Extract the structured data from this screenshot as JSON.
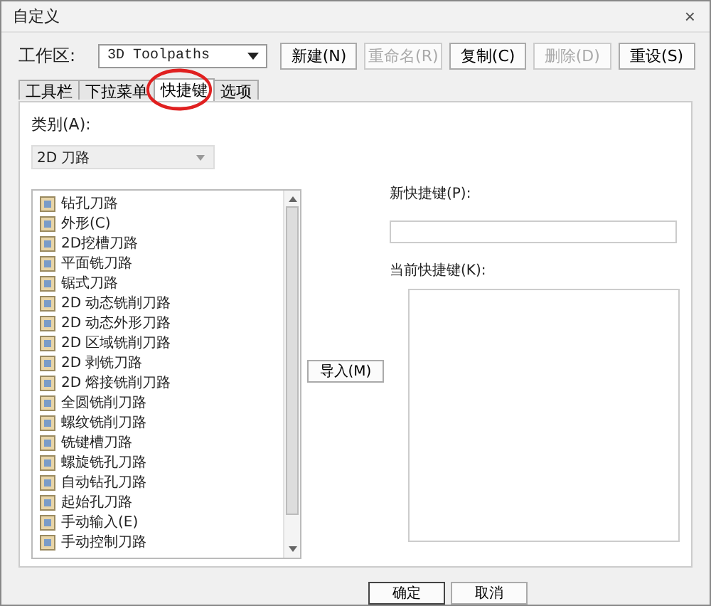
{
  "window": {
    "title": "自定义",
    "close": "×"
  },
  "workspace": {
    "label": "工作区:",
    "value": "3D Toolpaths"
  },
  "toolbar_buttons": [
    {
      "label": "新建(N)",
      "disabled": false
    },
    {
      "label": "重命名(R)",
      "disabled": true
    },
    {
      "label": "复制(C)",
      "disabled": false
    },
    {
      "label": "删除(D)",
      "disabled": true
    },
    {
      "label": "重设(S)",
      "disabled": false
    }
  ],
  "tabs": [
    {
      "label": "工具栏",
      "selected": false,
      "circled": false
    },
    {
      "label": "下拉菜单",
      "selected": false,
      "circled": false
    },
    {
      "label": "快捷键",
      "selected": true,
      "circled": true
    },
    {
      "label": "选项",
      "selected": false,
      "circled": false
    }
  ],
  "category": {
    "label": "类别(A):",
    "value": "2D 刀路"
  },
  "commands": [
    {
      "label": "钻孔刀路"
    },
    {
      "label": "外形(C)"
    },
    {
      "label": "2D挖槽刀路"
    },
    {
      "label": "平面铣刀路"
    },
    {
      "label": "锯式刀路"
    },
    {
      "label": "2D 动态铣削刀路"
    },
    {
      "label": "2D 动态外形刀路"
    },
    {
      "label": "2D 区域铣削刀路"
    },
    {
      "label": "2D 剥铣刀路"
    },
    {
      "label": "2D 熔接铣削刀路"
    },
    {
      "label": "全圆铣削刀路"
    },
    {
      "label": "螺纹铣削刀路"
    },
    {
      "label": "铣键槽刀路"
    },
    {
      "label": "螺旋铣孔刀路"
    },
    {
      "label": "自动钻孔刀路"
    },
    {
      "label": "起始孔刀路"
    },
    {
      "label": "手动输入(E)"
    },
    {
      "label": "手动控制刀路"
    }
  ],
  "import_button": "导入(M)",
  "new_shortcut": {
    "label": "新快捷键(P):"
  },
  "current_shortcuts": {
    "label": "当前快捷键(K):"
  },
  "footer_buttons": [
    "确定",
    "取消"
  ]
}
